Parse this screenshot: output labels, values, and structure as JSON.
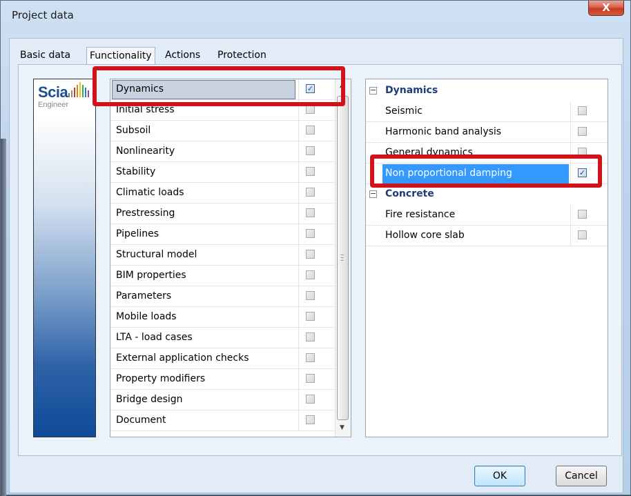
{
  "window": {
    "title": "Project data",
    "close_label": "X"
  },
  "tabs": [
    {
      "label": "Basic data",
      "active": false
    },
    {
      "label": "Functionality",
      "active": true
    },
    {
      "label": "Actions",
      "active": false
    },
    {
      "label": "Protection",
      "active": false
    }
  ],
  "logo": {
    "name": "Scia",
    "sub": "Engineer"
  },
  "functionality_list": [
    {
      "label": "Dynamics",
      "checked": true,
      "selected": true
    },
    {
      "label": "Initial stress",
      "checked": false
    },
    {
      "label": "Subsoil",
      "checked": false
    },
    {
      "label": "Nonlinearity",
      "checked": false
    },
    {
      "label": "Stability",
      "checked": false
    },
    {
      "label": "Climatic loads",
      "checked": false
    },
    {
      "label": "Prestressing",
      "checked": false
    },
    {
      "label": "Pipelines",
      "checked": false
    },
    {
      "label": "Structural model",
      "checked": false
    },
    {
      "label": "BIM properties",
      "checked": false
    },
    {
      "label": "Parameters",
      "checked": false
    },
    {
      "label": "Mobile loads",
      "checked": false
    },
    {
      "label": "LTA - load cases",
      "checked": false
    },
    {
      "label": "External application checks",
      "checked": false
    },
    {
      "label": "Property modifiers",
      "checked": false
    },
    {
      "label": "Bridge design",
      "checked": false
    },
    {
      "label": "Document",
      "checked": false
    }
  ],
  "detail_tree": [
    {
      "group": "Dynamics",
      "expander": "−",
      "items": [
        {
          "label": "Seismic",
          "checked": false
        },
        {
          "label": "Harmonic band analysis",
          "checked": false
        },
        {
          "label": "General dynamics",
          "checked": false
        },
        {
          "label": "Non proportional damping",
          "checked": true,
          "highlighted": true
        }
      ]
    },
    {
      "group": "Concrete",
      "expander": "−",
      "items": [
        {
          "label": "Fire resistance",
          "checked": false
        },
        {
          "label": "Hollow core slab",
          "checked": false
        }
      ]
    }
  ],
  "buttons": {
    "ok": "OK",
    "cancel": "Cancel"
  },
  "colors": {
    "highlight": "#d0121b",
    "selection": "#3399ff"
  }
}
